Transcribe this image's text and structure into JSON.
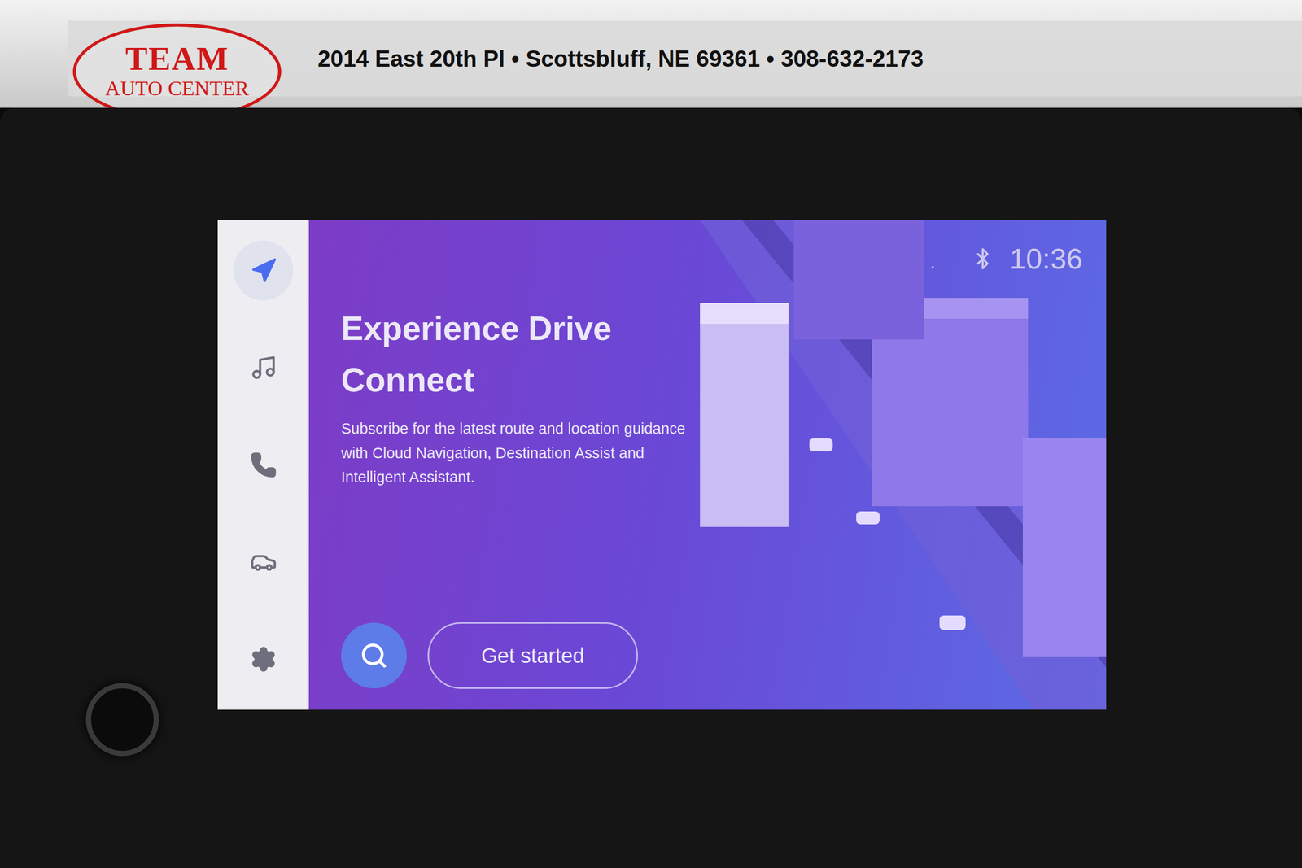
{
  "banner": {
    "logo_top": "TEAM",
    "logo_bottom": "AUTO CENTER",
    "address": "2014 East 20th Pl • Scottsbluff, NE 69361 • 308-632-2173"
  },
  "sidebar": {
    "items": [
      {
        "kind": "navigation",
        "selected": true
      },
      {
        "kind": "music",
        "selected": false
      },
      {
        "kind": "phone",
        "selected": false
      },
      {
        "kind": "vehicle",
        "selected": false
      },
      {
        "kind": "settings",
        "selected": false
      }
    ]
  },
  "status_bar": {
    "no_signal": true,
    "bluetooth": true,
    "time": "10:36"
  },
  "hero": {
    "title": "Experience Drive Connect",
    "description": "Subscribe for the latest route and location guidance with Cloud Navigation, Destination Assist and Intelligent Assistant.",
    "button": "Get started"
  }
}
